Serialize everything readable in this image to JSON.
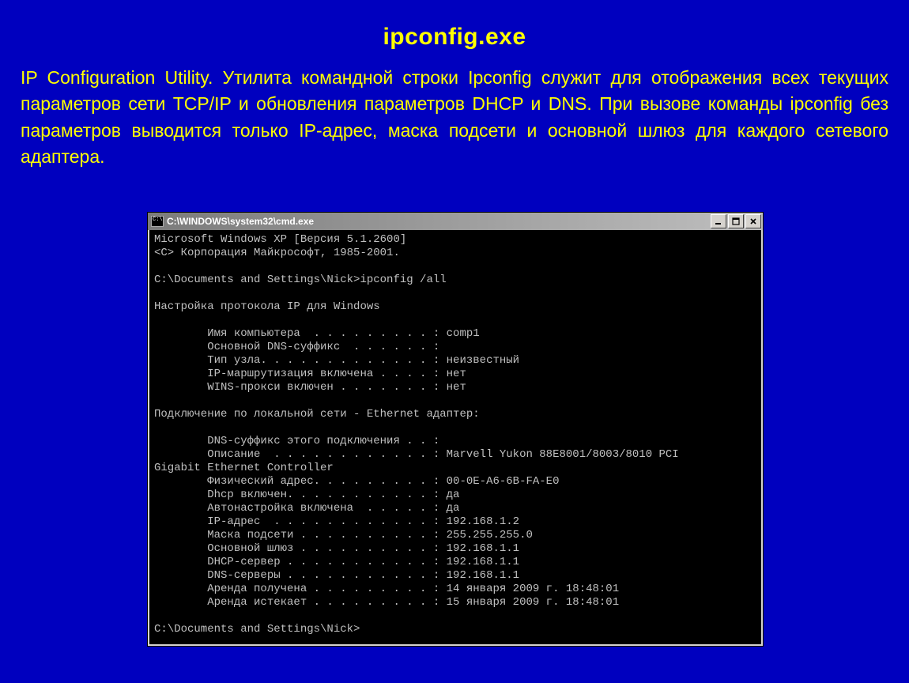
{
  "title": "ipconfig.exe",
  "body_text": "IP Configuration Utility. Утилита командной строки Ipconfig служит для отображения всех текущих параметров сети TCP/IP и обновления параметров DHCP и DNS. При вызове команды ipconfig без параметров выводится только IP-адрес, маска подсети и основной шлюз для каждого сетевого адаптера.",
  "window": {
    "title": "C:\\WINDOWS\\system32\\cmd.exe",
    "terminal_text": "Microsoft Windows XP [Версия 5.1.2600]\n<C> Корпорация Майкрософт, 1985-2001.\n\nC:\\Documents and Settings\\Nick>ipconfig /all\n\nНастройка протокола IP для Windows\n\n        Имя компьютера  . . . . . . . . . : comp1\n        Основной DNS-суффикс  . . . . . . :\n        Тип узла. . . . . . . . . . . . . : неизвестный\n        IP-маршрутизация включена . . . . : нет\n        WINS-прокси включен . . . . . . . : нет\n\nПодключение по локальной сети - Ethernet адаптер:\n\n        DNS-суффикс этого подключения . . :\n        Описание  . . . . . . . . . . . . : Marvell Yukon 88E8001/8003/8010 PCI\nGigabit Ethernet Controller\n        Физический адрес. . . . . . . . . : 00-0E-A6-6B-FA-E0\n        Dhcp включен. . . . . . . . . . . : да\n        Автонастройка включена  . . . . . : да\n        IP-адрес  . . . . . . . . . . . . : 192.168.1.2\n        Маска подсети . . . . . . . . . . : 255.255.255.0\n        Основной шлюз . . . . . . . . . . : 192.168.1.1\n        DHCP-сервер . . . . . . . . . . . : 192.168.1.1\n        DNS-серверы . . . . . . . . . . . : 192.168.1.1\n        Аренда получена . . . . . . . . . : 14 января 2009 г. 18:48:01\n        Аренда истекает . . . . . . . . . : 15 января 2009 г. 18:48:01\n\nC:\\Documents and Settings\\Nick>"
  }
}
